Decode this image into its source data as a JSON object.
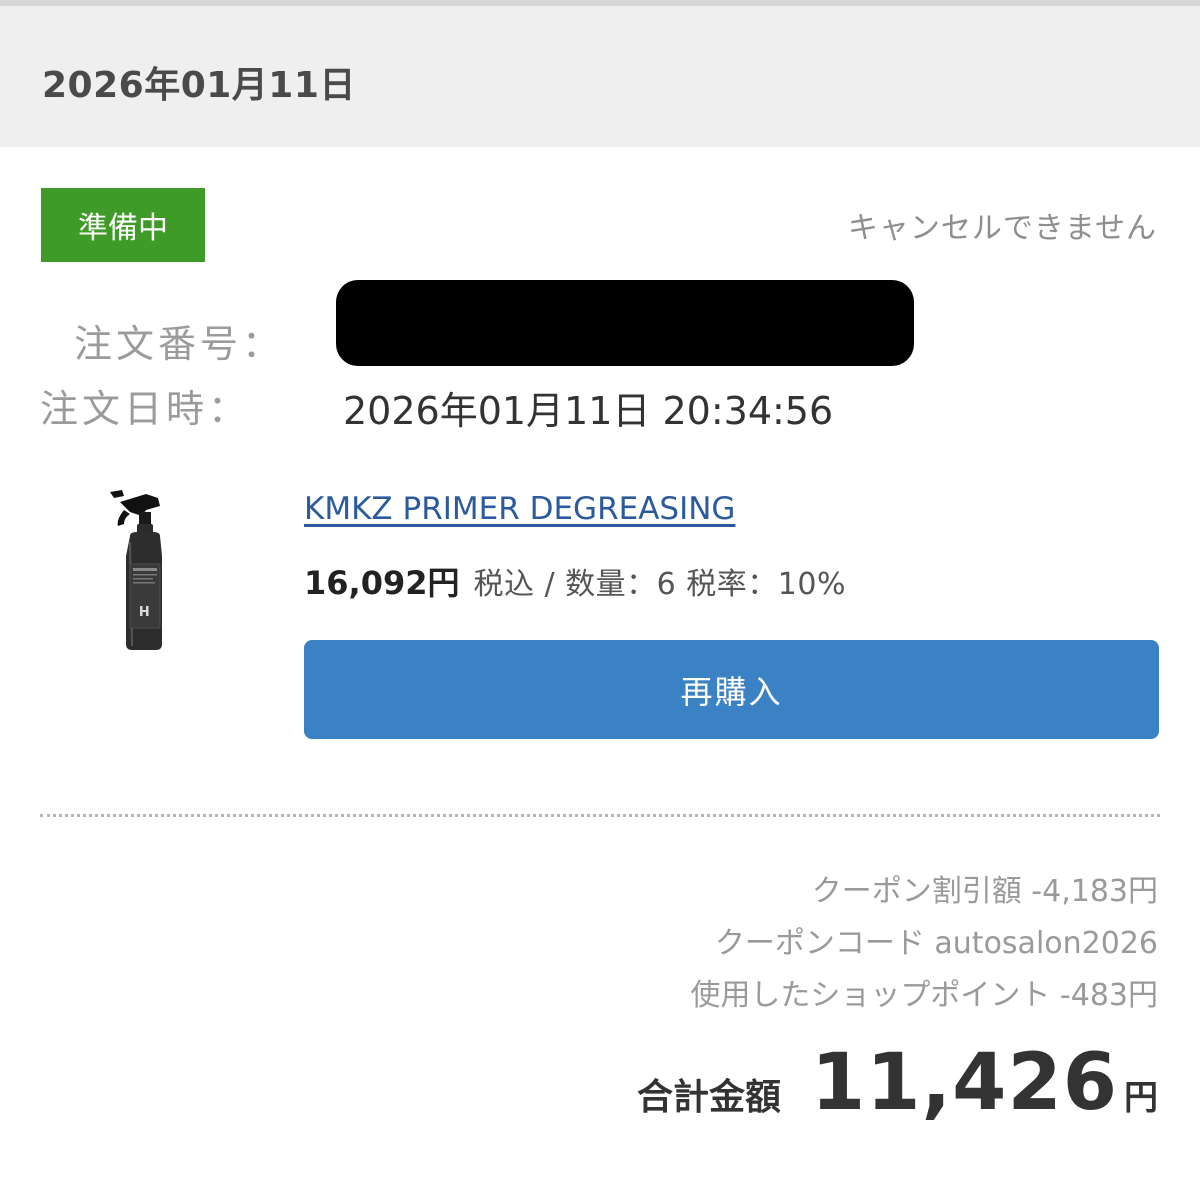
{
  "header": {
    "date": "2026年01月11日"
  },
  "order": {
    "status": "準備中",
    "cancel_note": "キャンセルできません",
    "number_label": "注文番号：",
    "date_label": "注文日時：",
    "date_value": "2026年01月11日 20:34:56"
  },
  "item": {
    "name": "KMKZ PRIMER DEGREASING",
    "price": "16,092円",
    "detail": "税込 / 数量：6 税率：10%",
    "rebuy_label": "再購入",
    "image_icon": "spray-bottle-icon"
  },
  "summary": {
    "coupon_discount": "クーポン割引額 -4,183円",
    "coupon_code": "クーポンコード autosalon2026",
    "points_used": "使用したショップポイント -483円",
    "total_label": "合計金額",
    "total_value": "11,426",
    "total_unit": "円"
  },
  "colors": {
    "status_badge": "#3f9b27",
    "rebuy_button": "#3b82c4",
    "link": "#2c5b9d"
  }
}
